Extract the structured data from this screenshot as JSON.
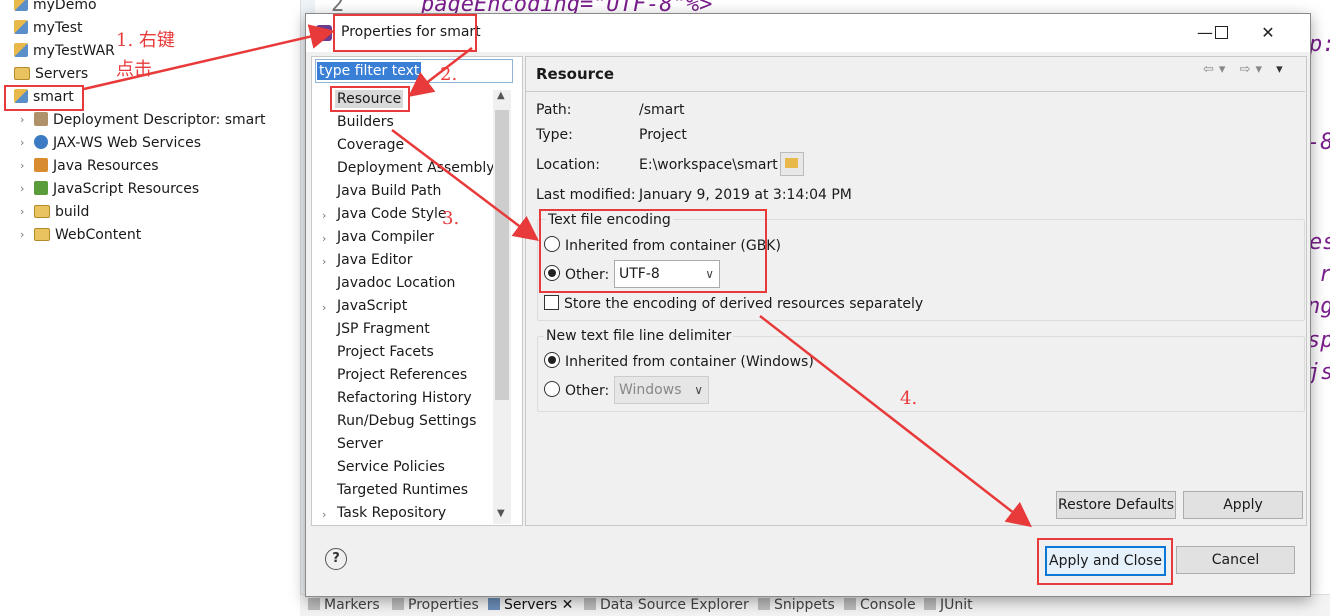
{
  "explorer": {
    "items": [
      {
        "label": "myDemo",
        "icon": "project-icon"
      },
      {
        "label": "myTest",
        "icon": "project-icon"
      },
      {
        "label": "myTestWAR",
        "icon": "project-icon"
      },
      {
        "label": "Servers",
        "icon": "folder-icon"
      },
      {
        "label": "smart",
        "icon": "project-icon"
      },
      {
        "label": "Deployment Descriptor: smart",
        "icon": "deployment-descriptor-icon"
      },
      {
        "label": "JAX-WS Web Services",
        "icon": "web-services-icon"
      },
      {
        "label": "Java Resources",
        "icon": "java-resources-icon"
      },
      {
        "label": "JavaScript Resources",
        "icon": "javascript-resources-icon"
      },
      {
        "label": "build",
        "icon": "folder-icon"
      },
      {
        "label": "WebContent",
        "icon": "folder-icon"
      }
    ]
  },
  "editor": {
    "line_number": "2",
    "line_text": "pageEncoding=\"UTF-8\"%>",
    "fragments": [
      "p:",
      "-8",
      "es",
      "r",
      "ng",
      "sp",
      "js"
    ]
  },
  "bottom_tabs": [
    "Markers",
    "Properties",
    "Servers",
    "Data Source Explorer",
    "Snippets",
    "Console",
    "JUnit"
  ],
  "dialog": {
    "title": "Properties for smart",
    "filter_placeholder": "type filter text",
    "nav_items": [
      "Resource",
      "Builders",
      "Coverage",
      "Deployment Assembly",
      "Java Build Path",
      "Java Code Style",
      "Java Compiler",
      "Java Editor",
      "Javadoc Location",
      "JavaScript",
      "JSP Fragment",
      "Project Facets",
      "Project References",
      "Refactoring History",
      "Run/Debug Settings",
      "Server",
      "Service Policies",
      "Targeted Runtimes",
      "Task Repository"
    ],
    "page_title": "Resource",
    "path_label": "Path:",
    "path_value": "/smart",
    "type_label": "Type:",
    "type_value": "Project",
    "location_label": "Location:",
    "location_value": "E:\\workspace\\smart",
    "modified_label": "Last modified:",
    "modified_value": "January 9, 2019 at 3:14:04 PM",
    "encoding_group": "Text file encoding",
    "encoding_inherited": "Inherited from container (GBK)",
    "encoding_other": "Other:",
    "encoding_value": "UTF-8",
    "derived_label": "Store the encoding of derived resources separately",
    "delimiter_group": "New text file line delimiter",
    "delimiter_inherited": "Inherited from container (Windows)",
    "delimiter_other": "Other:",
    "delimiter_value": "Windows",
    "restore_defaults": "Restore Defaults",
    "apply": "Apply",
    "apply_close": "Apply and Close",
    "cancel": "Cancel",
    "help": "?"
  },
  "annotations": {
    "step1": "1. 右键",
    "step1b": "点击",
    "step2": "2.",
    "step3": "3.",
    "step4": "4."
  },
  "colors": {
    "annotation_red": "#e83a3a",
    "selection_blue": "#3a7fd6"
  }
}
